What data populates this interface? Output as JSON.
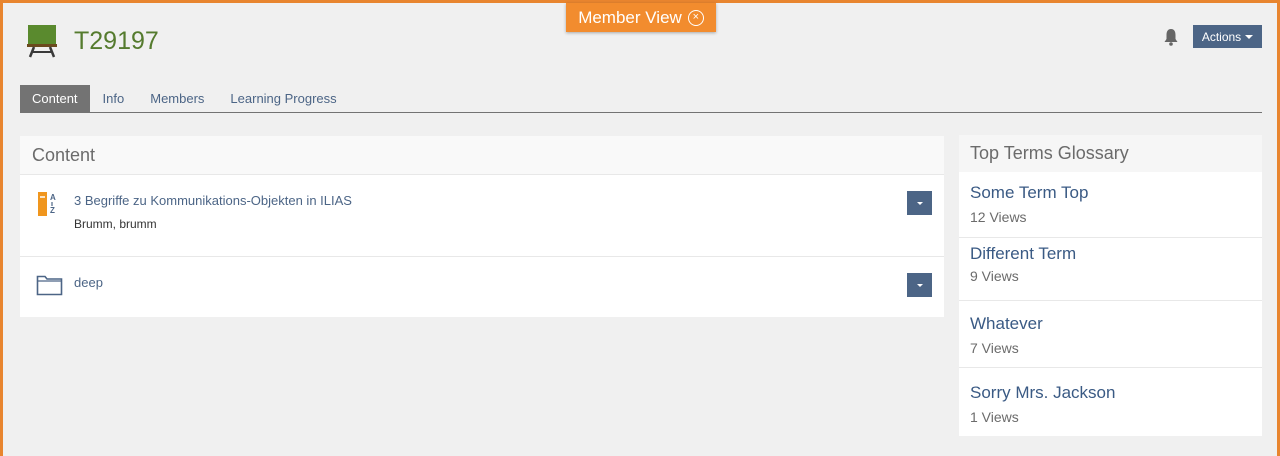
{
  "banner": {
    "label": "Member View",
    "close_symbol": "×"
  },
  "course": {
    "title": "T29197",
    "icon": "course-chalkboard-icon"
  },
  "header": {
    "actions_label": "Actions",
    "notification_icon": "bell-icon"
  },
  "tabs": [
    {
      "label": "Content",
      "active": true
    },
    {
      "label": "Info",
      "active": false
    },
    {
      "label": "Members",
      "active": false
    },
    {
      "label": "Learning Progress",
      "active": false
    }
  ],
  "content": {
    "heading": "Content",
    "items": [
      {
        "title": "3 Begriffe zu Kommunikations-Objekten in ILIAS",
        "subtitle": "Brumm, brumm",
        "icon": "glossary-icon"
      },
      {
        "title": "deep",
        "subtitle": "",
        "icon": "folder-icon"
      }
    ]
  },
  "glossary": {
    "heading": "Top Terms Glossary",
    "terms": [
      {
        "term": "Some Term Top",
        "views": "12 Views"
      },
      {
        "term": "Different Term",
        "views": "9 Views"
      },
      {
        "term": "Whatever",
        "views": "7 Views"
      },
      {
        "term": "Sorry Mrs. Jackson",
        "views": "1 Views"
      }
    ]
  },
  "colors": {
    "accent": "#f28c2e",
    "link": "#4c6586",
    "course_title": "#557b2e"
  }
}
